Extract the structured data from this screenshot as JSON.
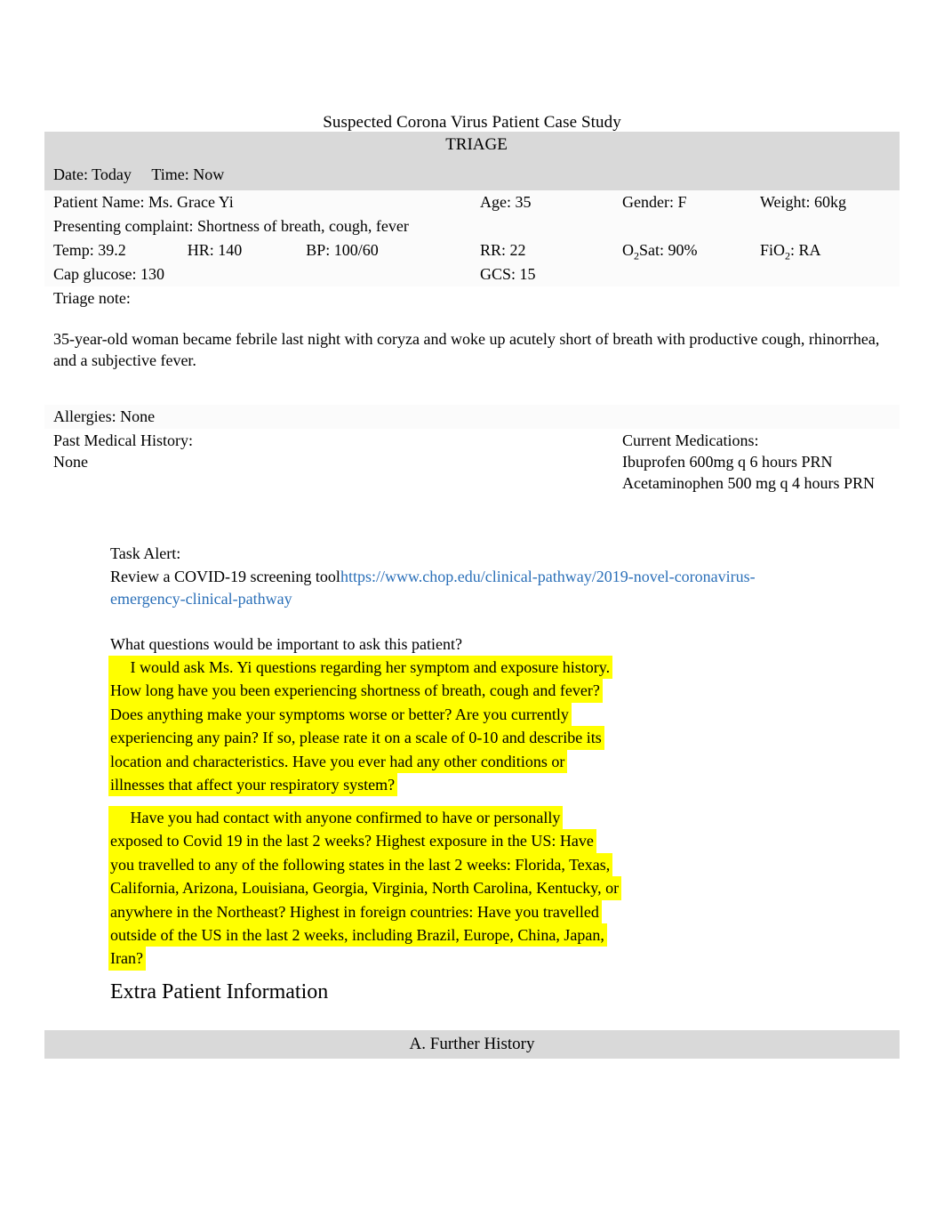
{
  "document": {
    "title": "Suspected Corona Virus Patient Case Study"
  },
  "triage": {
    "section_header": "TRIAGE",
    "date_label": "Date: Today",
    "time_label": "Time: Now",
    "patient_name": "Patient Name: Ms. Grace Yi",
    "age": "Age: 35",
    "gender": "Gender: F",
    "weight": "Weight: 60kg",
    "presenting_complaint": "Presenting complaint: Shortness of breath, cough, fever",
    "temp": "Temp: 39.2",
    "hr": "HR: 140",
    "bp": "BP: 100/60",
    "rr": "RR: 22",
    "o2sat_prefix": "O",
    "o2sat_sub": "2",
    "o2sat_value": "Sat: 90%",
    "fio2_prefix": "FiO",
    "fio2_sub": "2",
    "fio2_value": ": RA",
    "cap_glucose": "Cap glucose: 130",
    "gcs": "GCS: 15",
    "triage_note_label": "Triage note:",
    "triage_note_text": "35-year-old woman became febrile last night with coryza and woke up acutely short of breath with productive cough, rhinorrhea, and a subjective fever.",
    "allergies": "Allergies: None",
    "past_medical_history_label": "Past Medical History:",
    "past_medical_history_value": "None",
    "current_medications_label": "Current Medications:",
    "current_medications": [
      "Ibuprofen 600mg q 6 hours PRN",
      "Acetaminophen 500 mg q 4 hours PRN"
    ]
  },
  "task_alert": {
    "label": "Task Alert:",
    "instruction": "Review a COVID-19 screening tool",
    "link_line_1": "https://www.chop.edu/clinical-pathway/2019-novel-",
    "link_line_2": "coronavirus-emergency-clinical-pathway",
    "link_color": "#2a6fb8"
  },
  "questions_section": {
    "heading": "What questions would be important to ask this patient?",
    "highlight_color": "#ffff00",
    "answer_symptoms_lines": [
      "     I would ask Ms. Yi questions regarding her symptom and exposure history.",
      "How long have you been experiencing shortness of breath, cough and fever?",
      "Does anything make your symptoms worse or better? Are you currently",
      "experiencing any pain? If so, please rate it on a scale of 0-10 and describe its",
      "location and characteristics. Have you ever had any other conditions or",
      "illnesses that affect your respiratory system?"
    ],
    "answer_exposure_lines": [
      "     Have you had contact with anyone confirmed to have or personally",
      "exposed to Covid 19 in the last 2 weeks? Highest exposure in the US: Have",
      "you travelled to any of the following states in the last 2 weeks: Florida, Texas,",
      "California, Arizona, Louisiana, Georgia, Virginia, North Carolina, Kentucky, or",
      "anywhere in the Northeast? Highest in foreign countries: Have you travelled",
      "outside of the US in the last 2 weeks, including Brazil, Europe, China, Japan,",
      "Iran?"
    ]
  },
  "extra_information": {
    "heading": "Extra Patient Information",
    "further_history_header": "A. Further History"
  }
}
